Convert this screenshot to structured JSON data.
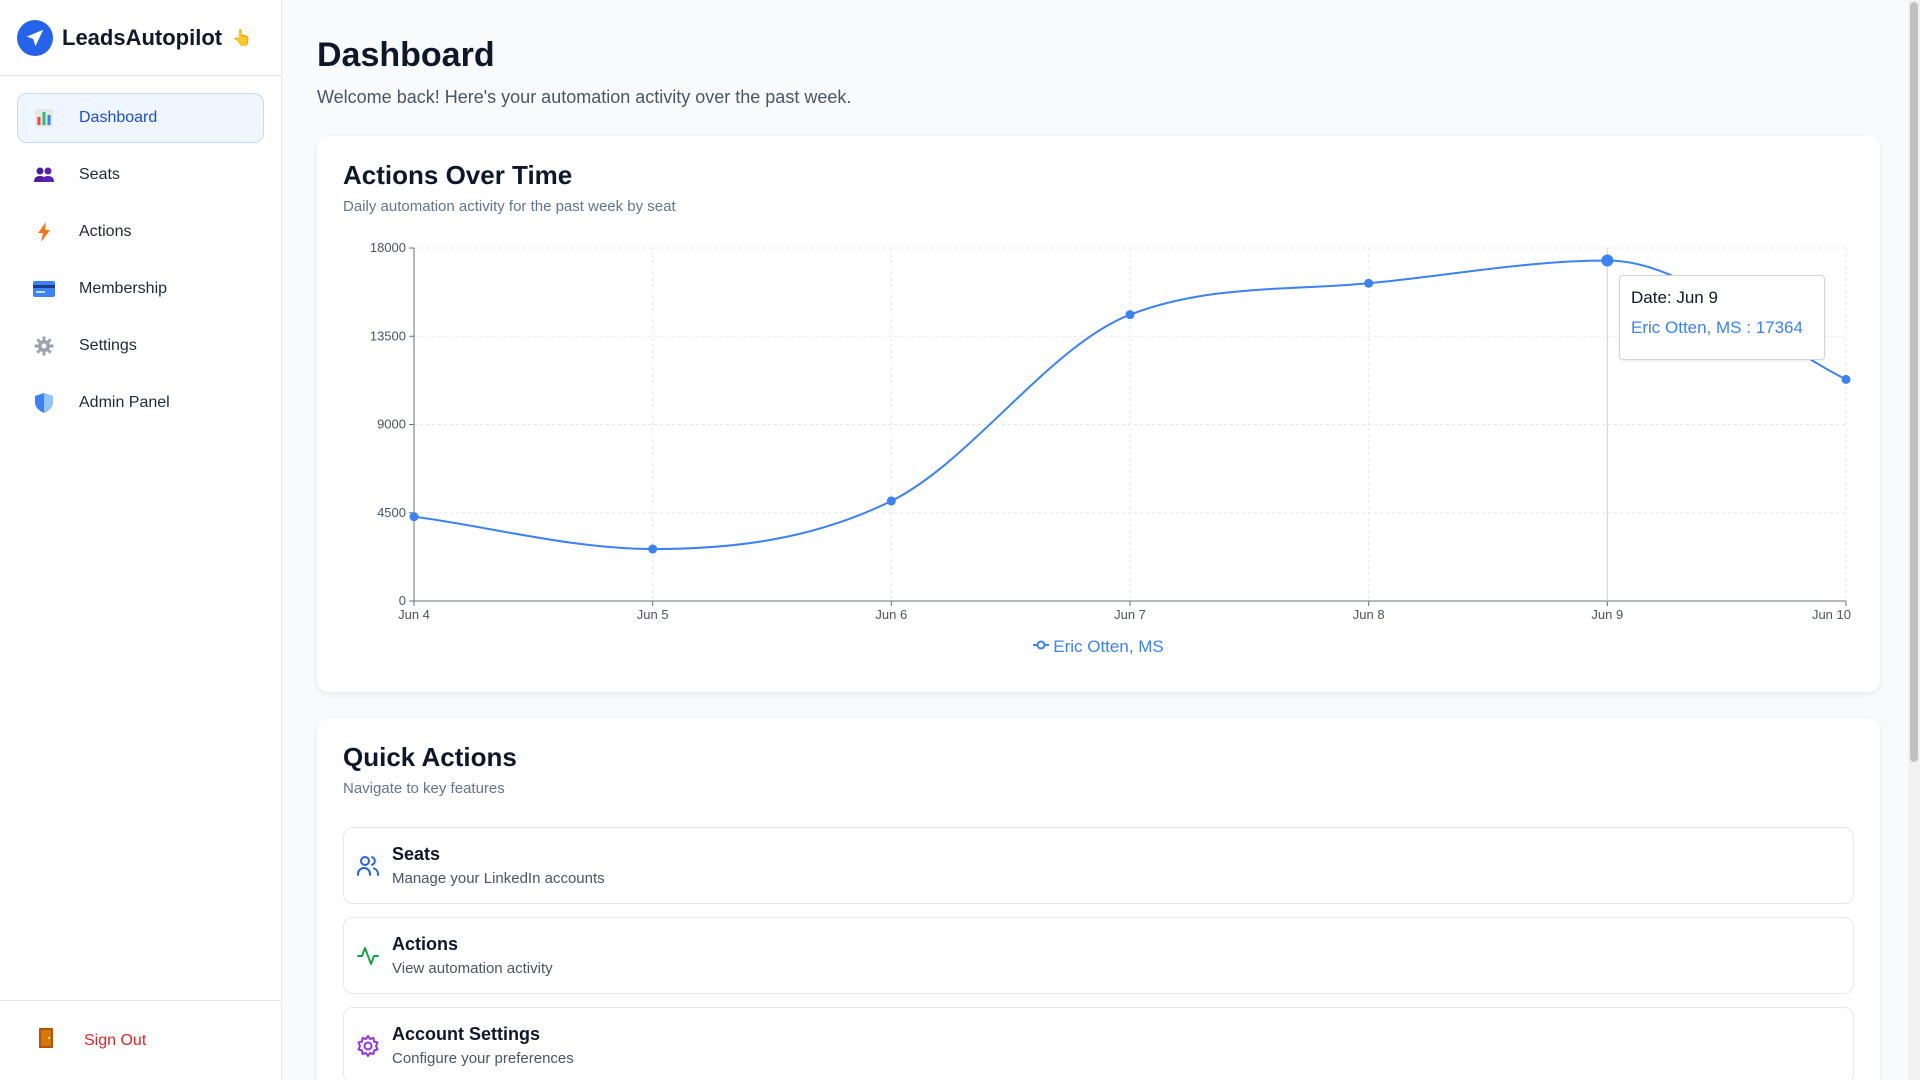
{
  "brand": {
    "name": "LeadsAutopilot",
    "emoji": "👆"
  },
  "sidebar": {
    "items": [
      {
        "label": "Dashboard",
        "icon": "bar-chart-icon",
        "active": true
      },
      {
        "label": "Seats",
        "icon": "users-icon"
      },
      {
        "label": "Actions",
        "icon": "lightning-icon"
      },
      {
        "label": "Membership",
        "icon": "credit-card-icon"
      },
      {
        "label": "Settings",
        "icon": "gear-icon"
      },
      {
        "label": "Admin Panel",
        "icon": "shield-icon"
      }
    ],
    "signout": {
      "label": "Sign Out",
      "icon": "door-icon"
    }
  },
  "header": {
    "title": "Dashboard",
    "subtitle": "Welcome back! Here's your automation activity over the past week."
  },
  "chart_card": {
    "title": "Actions Over Time",
    "subtitle": "Daily automation activity for the past week by seat",
    "tooltip": {
      "date_line": "Date: Jun 9",
      "value_line": "Eric Otten, MS : 17364"
    },
    "legend_label": "Eric Otten, MS"
  },
  "chart_data": {
    "type": "line",
    "title": "Actions Over Time",
    "categories": [
      "Jun 4",
      "Jun 5",
      "Jun 6",
      "Jun 7",
      "Jun 8",
      "Jun 9",
      "Jun 10"
    ],
    "series": [
      {
        "name": "Eric Otten, MS",
        "values": [
          4300,
          2650,
          5100,
          14600,
          16200,
          17364,
          11300
        ]
      }
    ],
    "y_ticks": [
      0,
      4500,
      9000,
      13500,
      18000
    ],
    "ylim": [
      0,
      18000
    ],
    "grid": true,
    "legend_position": "bottom",
    "highlight_index": 5,
    "color": "#3b82f6"
  },
  "quick_actions": {
    "title": "Quick Actions",
    "subtitle": "Navigate to key features",
    "items": [
      {
        "title": "Seats",
        "desc": "Manage your LinkedIn accounts",
        "icon": "users-icon"
      },
      {
        "title": "Actions",
        "desc": "View automation activity",
        "icon": "activity-icon"
      },
      {
        "title": "Account Settings",
        "desc": "Configure your preferences",
        "icon": "gear-icon"
      }
    ]
  },
  "colors": {
    "accent": "#3b82f6",
    "active_nav_bg": "#eff6ff",
    "danger": "#dc2626"
  }
}
